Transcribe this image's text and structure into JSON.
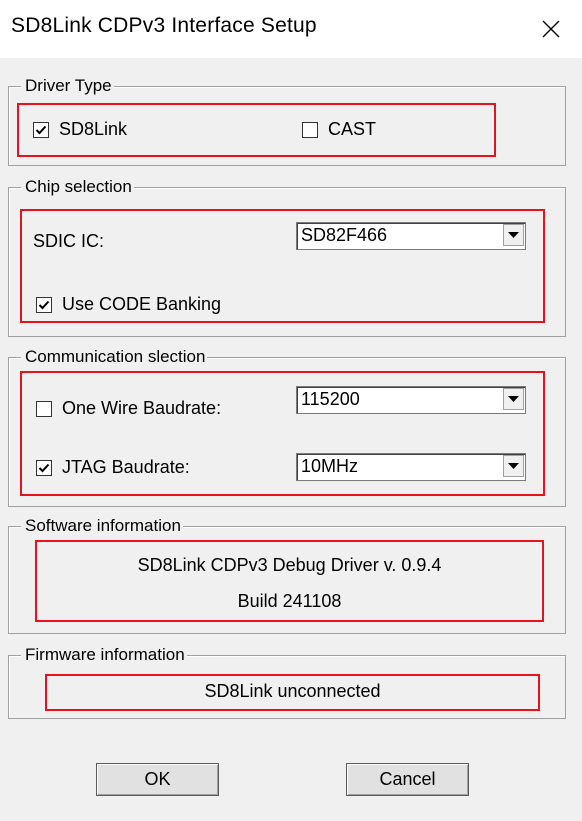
{
  "window": {
    "title": "SD8Link CDPv3 Interface Setup"
  },
  "driver_type": {
    "legend": "Driver Type",
    "sd8link": {
      "label": "SD8Link",
      "checked": true
    },
    "cast": {
      "label": "CAST",
      "checked": false
    }
  },
  "chip_selection": {
    "legend": "Chip selection",
    "sdic_label": "SDIC IC:",
    "sdic_value": "SD82F466",
    "code_banking": {
      "label": "Use CODE Banking",
      "checked": true
    }
  },
  "communication": {
    "legend": "Communication slection",
    "one_wire": {
      "label": "One Wire Baudrate:",
      "checked": false,
      "value": "115200"
    },
    "jtag": {
      "label": "JTAG Baudrate:",
      "checked": true,
      "value": "10MHz"
    }
  },
  "software_info": {
    "legend": "Software information",
    "line1": "SD8Link CDPv3 Debug Driver v. 0.9.4",
    "line2": "Build 241108"
  },
  "firmware_info": {
    "legend": "Firmware information",
    "status": "SD8Link unconnected"
  },
  "buttons": {
    "ok": "OK",
    "cancel": "Cancel"
  },
  "icons": {
    "close": "close-icon",
    "check": "check-icon",
    "dropdown": "chevron-down-icon"
  }
}
